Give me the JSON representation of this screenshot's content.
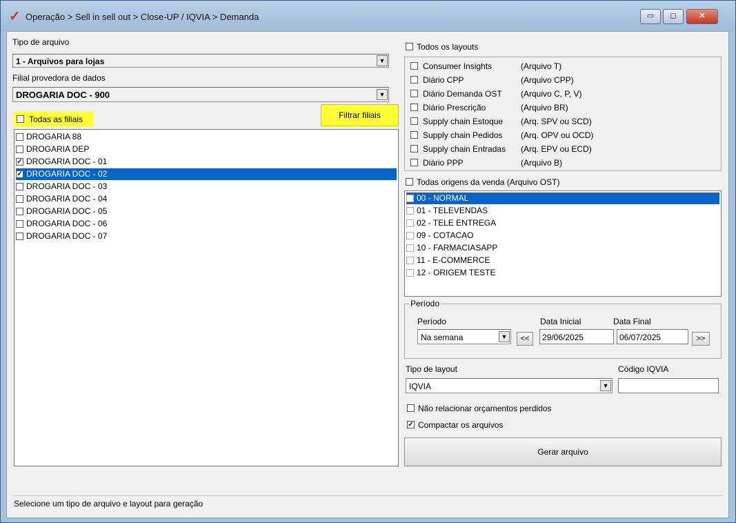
{
  "window": {
    "title": "Operação > Sell in sell out > Close-UP / IQVIA > Demanda",
    "minimize_label": "▭",
    "maximize_label": "◻",
    "close_label": "✕"
  },
  "left": {
    "tipo_arquivo_label": "Tipo de arquivo",
    "tipo_arquivo_value": "1 - Arquivos para lojas",
    "filial_label": "Filial provedora de dados",
    "filial_value": "DROGARIA DOC - 900",
    "todas_filiais_label": "Todas as filiais",
    "filtrar_button": "Filtrar filiais",
    "filiais": [
      {
        "name": "DROGARIA 88",
        "checked": false,
        "selected": false
      },
      {
        "name": "DROGARIA DEP",
        "checked": false,
        "selected": false
      },
      {
        "name": "DROGARIA DOC - 01",
        "checked": true,
        "selected": false
      },
      {
        "name": "DROGARIA DOC - 02",
        "checked": true,
        "selected": true
      },
      {
        "name": "DROGARIA DOC - 03",
        "checked": false,
        "selected": false
      },
      {
        "name": "DROGARIA DOC - 04",
        "checked": false,
        "selected": false
      },
      {
        "name": "DROGARIA DOC - 05",
        "checked": false,
        "selected": false
      },
      {
        "name": "DROGARIA DOC - 06",
        "checked": false,
        "selected": false
      },
      {
        "name": "DROGARIA DOC - 07",
        "checked": false,
        "selected": false
      }
    ]
  },
  "right": {
    "todos_layouts_label": "Todos os layouts",
    "layouts": [
      {
        "name": "Consumer Insights",
        "file": "(Arquivo T)"
      },
      {
        "name": "Diário CPP",
        "file": "(Arquivo CPP)"
      },
      {
        "name": "Diário Demanda OST",
        "file": "(Arquivo C, P, V)"
      },
      {
        "name": "Diário Prescrição",
        "file": "(Arquivo BR)"
      },
      {
        "name": "Supply chain Estoque",
        "file": "(Arq. SPV ou SCD)"
      },
      {
        "name": "Supply chain Pedidos",
        "file": "(Arq. OPV ou OCD)"
      },
      {
        "name": "Supply chain Entradas",
        "file": "(Arq. EPV ou ECD)"
      },
      {
        "name": "Diário PPP",
        "file": "(Arquivo B)"
      }
    ],
    "todas_origens_label": "Todas origens da venda (Arquivo OST)",
    "origens": [
      {
        "name": "00 - NORMAL",
        "selected": true
      },
      {
        "name": "01 - TELEVENDAS",
        "selected": false
      },
      {
        "name": "02 - TELE ENTREGA",
        "selected": false
      },
      {
        "name": "09 - COTACAO",
        "selected": false
      },
      {
        "name": "10 - FARMACIASAPP",
        "selected": false
      },
      {
        "name": "11 - E-COMMERCE",
        "selected": false
      },
      {
        "name": "12 - ORIGEM TESTE",
        "selected": false
      }
    ],
    "periodo_group": "Período",
    "periodo_label": "Período",
    "periodo_value": "Na semana",
    "data_inicial_label": "Data Inicial",
    "data_inicial_value": "29/06/2025",
    "data_final_label": "Data Final",
    "data_final_value": "06/07/2025",
    "prev_label": "<<",
    "next_label": ">>",
    "tipo_layout_label": "Tipo de layout",
    "tipo_layout_value": "IQVIA",
    "codigo_iqvia_label": "Código IQVIA",
    "codigo_iqvia_value": "",
    "nao_relacionar_label": "Não relacionar orçamentos perdidos",
    "nao_relacionar_checked": false,
    "compactar_label": "Compactar os arquivos",
    "compactar_checked": true,
    "gerar_button": "Gerar arquivo"
  },
  "status_text": "Selecione um tipo de arquivo e layout para geração",
  "colors": {
    "highlight": "#ffff33",
    "selection": "#0a64c8"
  }
}
